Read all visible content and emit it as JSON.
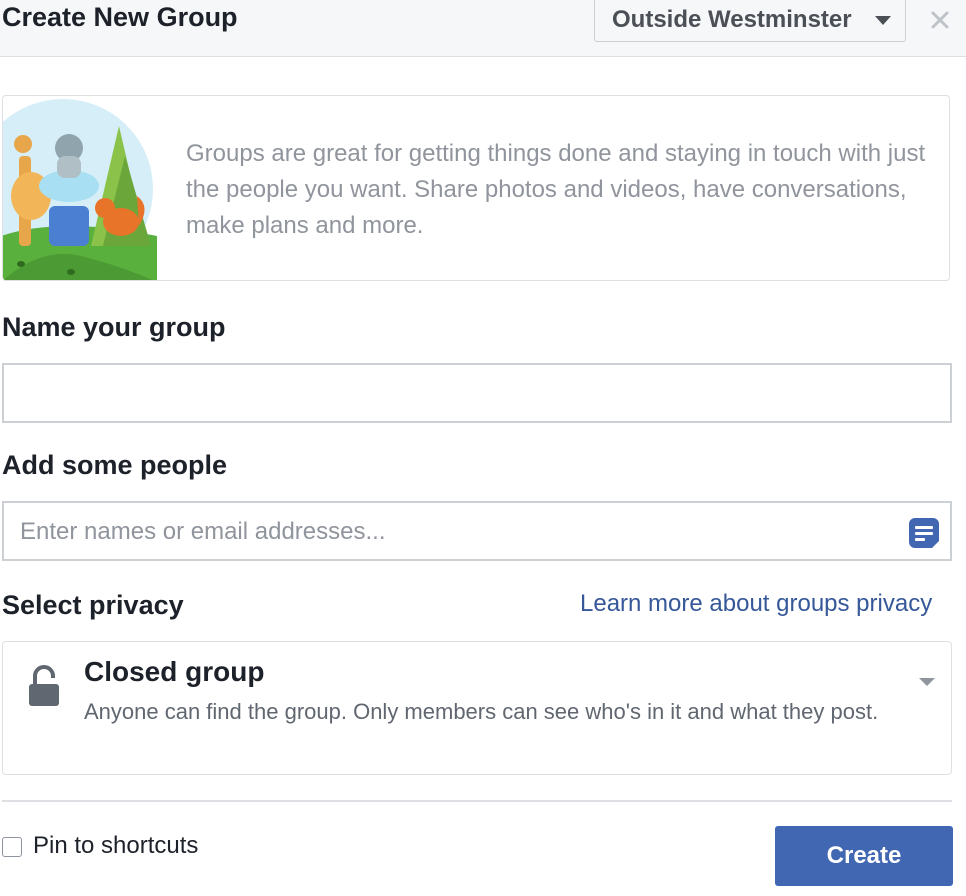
{
  "header": {
    "title": "Create New Group",
    "context_selector": "Outside Westminster",
    "close_icon": "close-icon"
  },
  "intro": {
    "illustration": "animals-group-illustration",
    "text": "Groups are great for getting things done and staying in touch with just the people you want. Share photos and videos, have conversations, make plans and more."
  },
  "name_section": {
    "label": "Name your group",
    "value": "",
    "placeholder": ""
  },
  "people_section": {
    "label": "Add some people",
    "value": "",
    "placeholder": "Enter names or email addresses...",
    "icon": "contacts-list-icon"
  },
  "privacy_section": {
    "label": "Select privacy",
    "learn_more_link": "Learn more about groups privacy",
    "selected": {
      "icon": "lock-icon",
      "title": "Closed group",
      "description": "Anyone can find the group. Only members can see who's in it and what they post."
    }
  },
  "footer": {
    "pin_label": "Pin to shortcuts",
    "pin_checked": false,
    "create_button": "Create"
  },
  "colors": {
    "accent": "#4267b2",
    "link": "#365899",
    "header_bg": "#f6f7f9",
    "border": "#dddfe2",
    "muted_text": "#90949c"
  }
}
